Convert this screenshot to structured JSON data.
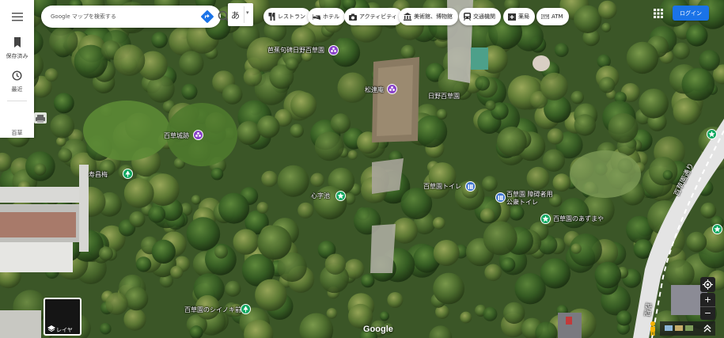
{
  "search": {
    "placeholder": "Google マップを検索する"
  },
  "ime": {
    "char": "あ"
  },
  "rail": {
    "menu_label": "",
    "saved_label": "保存済み",
    "recent_label": "最近",
    "place_label": "百草"
  },
  "chips": [
    {
      "label": "レストラン",
      "icon": "restaurant-icon"
    },
    {
      "label": "ホテル",
      "icon": "hotel-icon"
    },
    {
      "label": "アクティビティ",
      "icon": "camera-icon"
    },
    {
      "label": "美術館、博物館",
      "icon": "museum-icon"
    },
    {
      "label": "交通機関",
      "icon": "transit-icon"
    },
    {
      "label": "薬局",
      "icon": "pharmacy-icon"
    },
    {
      "label": "ATM",
      "icon": "atm-icon"
    }
  ],
  "login": {
    "label": "ログイン"
  },
  "places": [
    {
      "name": "芭蕉句碑日野百草園",
      "kind": "purple"
    },
    {
      "name": "松連庵",
      "kind": "purple"
    },
    {
      "name": "日野百草園",
      "kind": "purple"
    },
    {
      "name": "百草城跡",
      "kind": "purple"
    },
    {
      "name": "寿昌梅",
      "kind": "green"
    },
    {
      "name": "心字池",
      "kind": "green"
    },
    {
      "name": "百草園トイレ",
      "kind": "blue"
    },
    {
      "name": "百草園 障碍者用公衆トイレ",
      "kind": "blue"
    },
    {
      "name": "百草園のあずまや",
      "kind": "green"
    },
    {
      "name": "百草園のシイノキ前",
      "kind": "green"
    }
  ],
  "roads": [
    "百草園通り",
    "百草"
  ],
  "layer": {
    "label": "レイヤ"
  },
  "branding": {
    "logo": "Google"
  },
  "colors": {
    "accent": "#1a73e8",
    "pin_purple": "#8a43c9",
    "pin_green": "#10a860",
    "pin_blue": "#3f75ce"
  }
}
